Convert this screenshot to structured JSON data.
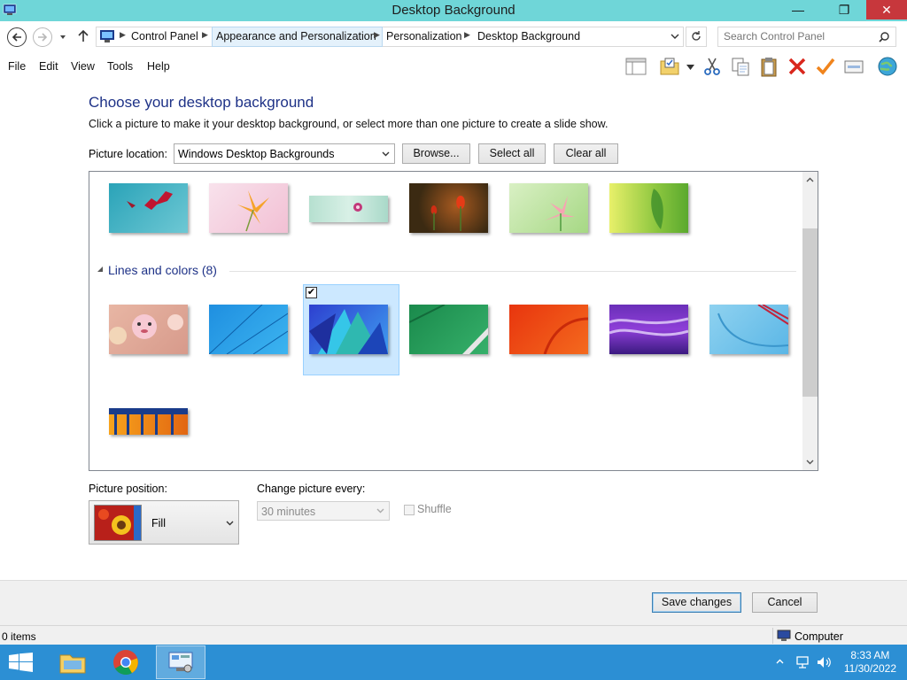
{
  "window": {
    "title": "Desktop Background",
    "controls": {
      "minimize": "—",
      "maximize": "❐",
      "close": "✕"
    }
  },
  "address": {
    "breadcrumb": [
      "Control Panel",
      "Appearance and Personalization",
      "Personalization",
      "Desktop Background"
    ],
    "search_placeholder": "Search Control Panel"
  },
  "menu": [
    "File",
    "Edit",
    "View",
    "Tools",
    "Help"
  ],
  "toolbar_icons": [
    "layout-icon",
    "folder-options-icon",
    "cut-icon",
    "copy-icon",
    "paste-icon",
    "delete-icon",
    "check-icon",
    "properties-icon",
    "globe-icon"
  ],
  "main": {
    "heading": "Choose your desktop background",
    "instructions": "Click a picture to make it your desktop background, or select more than one picture to create a slide show.",
    "picture_location_label": "Picture location:",
    "picture_location_value": "Windows Desktop Backgrounds",
    "browse_label": "Browse...",
    "select_all_label": "Select all",
    "clear_all_label": "Clear all",
    "group_title": "Lines and colors (8)",
    "picture_position_label": "Picture position:",
    "picture_position_value": "Fill",
    "change_every_label": "Change picture every:",
    "change_every_value": "30 minutes",
    "shuffle_label": "Shuffle",
    "save_label": "Save changes",
    "cancel_label": "Cancel"
  },
  "status": {
    "items": "0 items",
    "zone": "Computer"
  },
  "taskbar": {
    "time": "8:33 AM",
    "date": "11/30/2022"
  },
  "colors": {
    "titlebar": "#6fd6d8",
    "heading": "#1e3287",
    "taskbar": "#2c8fd4",
    "selection": "#cce8ff"
  }
}
